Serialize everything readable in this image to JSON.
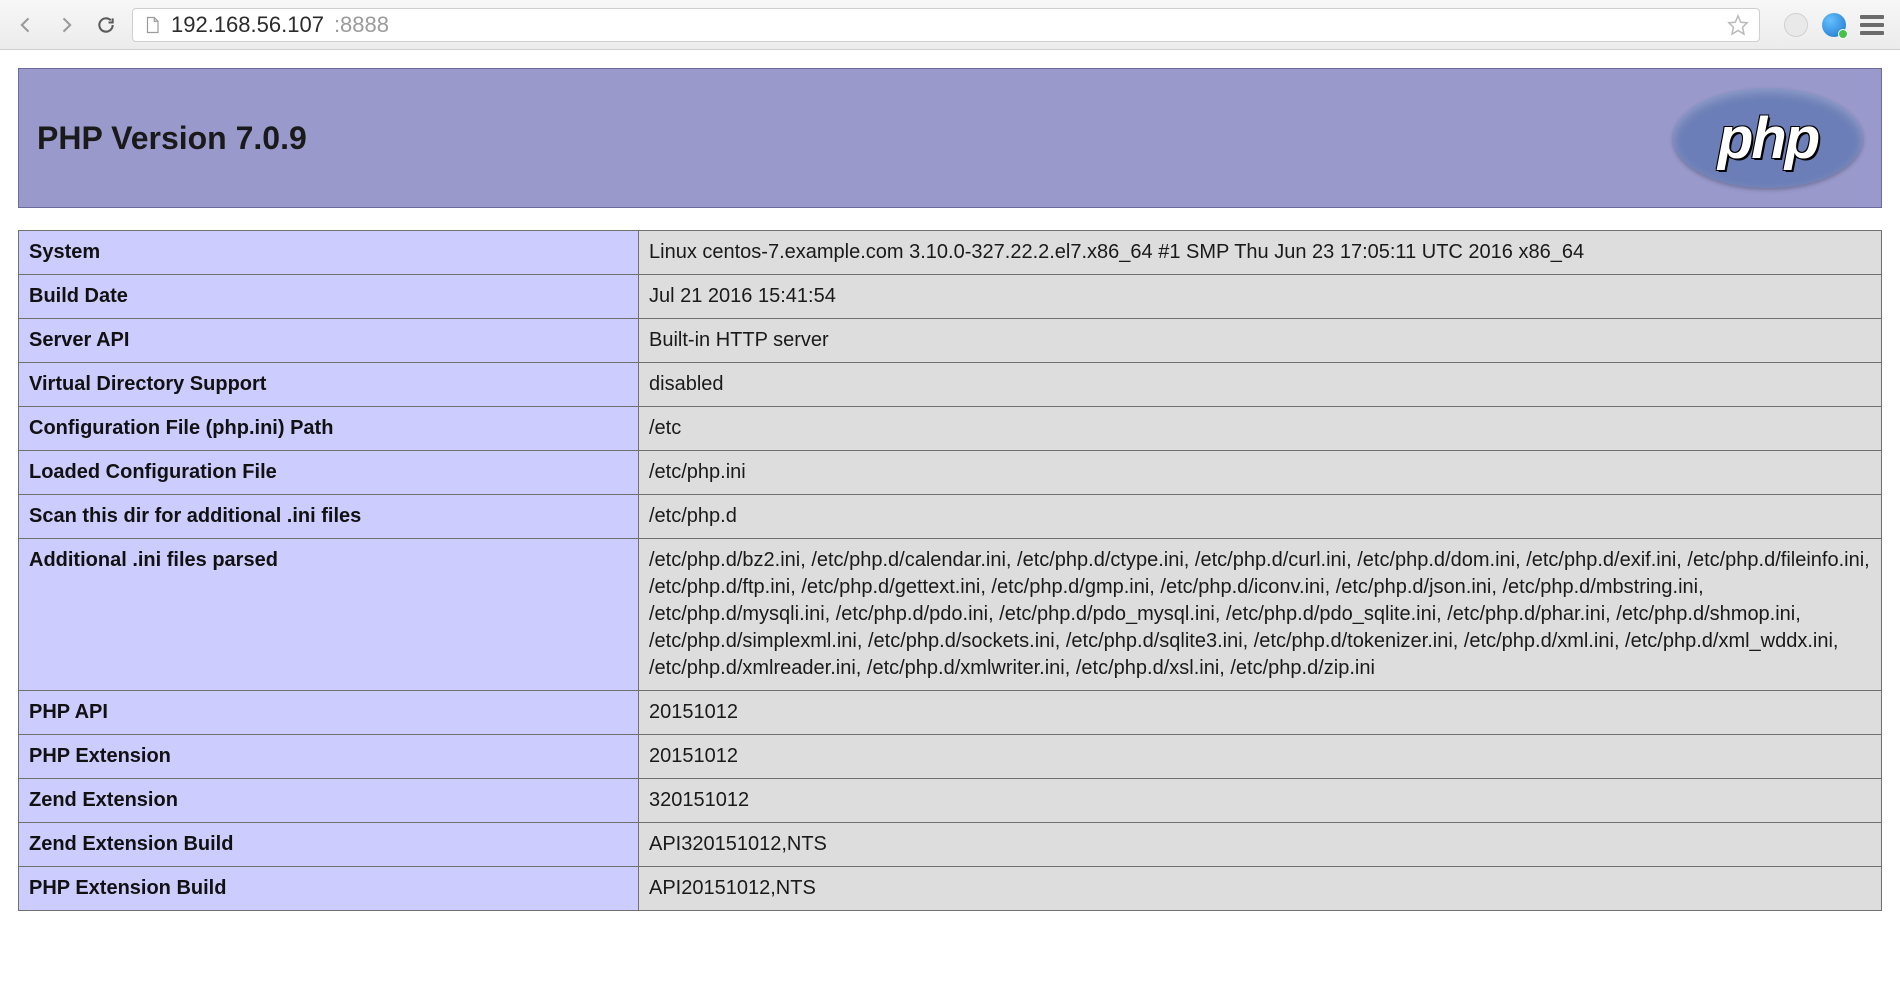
{
  "browser": {
    "url_host": "192.168.56.107",
    "url_port": ":8888"
  },
  "header": {
    "title": "PHP Version 7.0.9",
    "logo_text": "php"
  },
  "rows": [
    {
      "k": "System",
      "v": "Linux centos-7.example.com 3.10.0-327.22.2.el7.x86_64 #1 SMP Thu Jun 23 17:05:11 UTC 2016 x86_64"
    },
    {
      "k": "Build Date",
      "v": "Jul 21 2016 15:41:54"
    },
    {
      "k": "Server API",
      "v": "Built-in HTTP server"
    },
    {
      "k": "Virtual Directory Support",
      "v": "disabled"
    },
    {
      "k": "Configuration File (php.ini) Path",
      "v": "/etc"
    },
    {
      "k": "Loaded Configuration File",
      "v": "/etc/php.ini"
    },
    {
      "k": "Scan this dir for additional .ini files",
      "v": "/etc/php.d"
    },
    {
      "k": "Additional .ini files parsed",
      "v": "/etc/php.d/bz2.ini, /etc/php.d/calendar.ini, /etc/php.d/ctype.ini, /etc/php.d/curl.ini, /etc/php.d/dom.ini, /etc/php.d/exif.ini, /etc/php.d/fileinfo.ini, /etc/php.d/ftp.ini, /etc/php.d/gettext.ini, /etc/php.d/gmp.ini, /etc/php.d/iconv.ini, /etc/php.d/json.ini, /etc/php.d/mbstring.ini, /etc/php.d/mysqli.ini, /etc/php.d/pdo.ini, /etc/php.d/pdo_mysql.ini, /etc/php.d/pdo_sqlite.ini, /etc/php.d/phar.ini, /etc/php.d/shmop.ini, /etc/php.d/simplexml.ini, /etc/php.d/sockets.ini, /etc/php.d/sqlite3.ini, /etc/php.d/tokenizer.ini, /etc/php.d/xml.ini, /etc/php.d/xml_wddx.ini, /etc/php.d/xmlreader.ini, /etc/php.d/xmlwriter.ini, /etc/php.d/xsl.ini, /etc/php.d/zip.ini"
    },
    {
      "k": "PHP API",
      "v": "20151012"
    },
    {
      "k": "PHP Extension",
      "v": "20151012"
    },
    {
      "k": "Zend Extension",
      "v": "320151012"
    },
    {
      "k": "Zend Extension Build",
      "v": "API320151012,NTS"
    },
    {
      "k": "PHP Extension Build",
      "v": "API20151012,NTS"
    }
  ]
}
